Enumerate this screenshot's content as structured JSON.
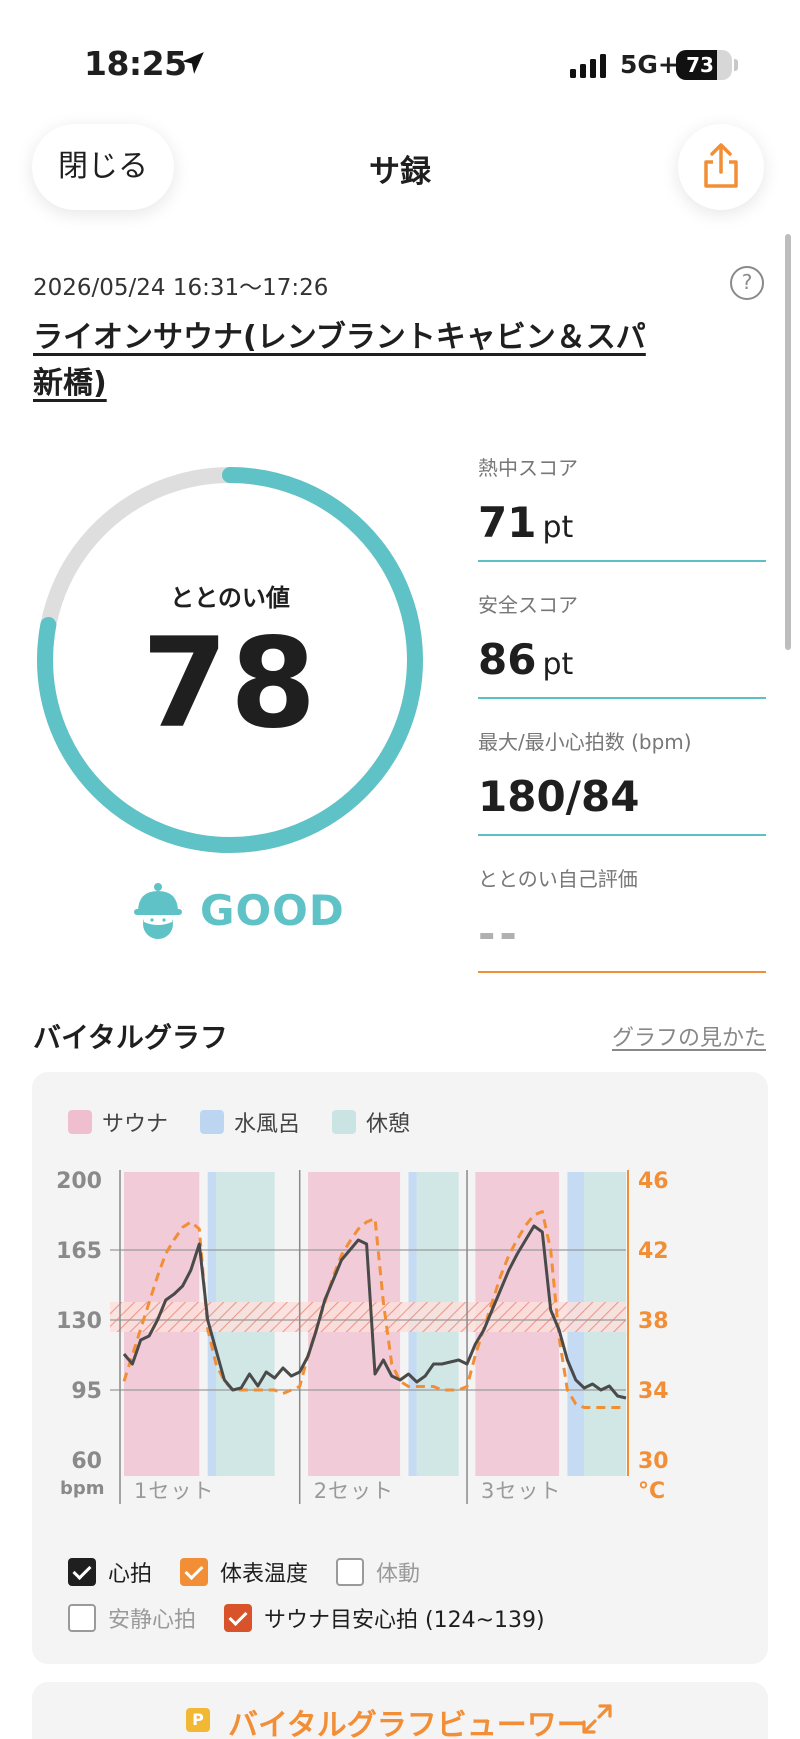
{
  "status_bar": {
    "time": "18:25",
    "network": "5G+",
    "battery": "73",
    "battery_level": 0.73
  },
  "header": {
    "close_label": "閉じる",
    "title": "サ録"
  },
  "record": {
    "datetime": "2026/05/24 16:31〜17:26",
    "facility": "ライオンサウナ(レンブラントキャビン＆スパ新橋)"
  },
  "gauge": {
    "label": "ととのい値",
    "value": "78",
    "level": 0.78,
    "rating": "GOOD"
  },
  "scores": [
    {
      "label": "熱中スコア",
      "value": "71",
      "unit": "pt"
    },
    {
      "label": "安全スコア",
      "value": "86",
      "unit": "pt"
    },
    {
      "label": "最大/最小心拍数 (bpm)",
      "value": "180/84",
      "unit": ""
    },
    {
      "label": "ととのい自己評価",
      "value": "--",
      "unit": ""
    }
  ],
  "vital": {
    "title": "バイタルグラフ",
    "howto_link": "グラフの見かた",
    "legend": [
      {
        "label": "サウナ",
        "color": "#f0bfcf"
      },
      {
        "label": "水風呂",
        "color": "#bcd6f2"
      },
      {
        "label": "休憩",
        "color": "#c9e4e3"
      }
    ],
    "checks": [
      {
        "label": "心拍",
        "checked": true,
        "color": "#1f1f1f"
      },
      {
        "label": "体表温度",
        "checked": true,
        "color": "#f28e36"
      },
      {
        "label": "体動",
        "checked": false,
        "color": ""
      },
      {
        "label": "安静心拍",
        "checked": false,
        "color": ""
      },
      {
        "label": "サウナ目安心拍 (124~139)",
        "checked": true,
        "color": "#d8532a"
      }
    ],
    "viewer_label": "バイタルグラフビューワー",
    "viewer_badge": "P"
  },
  "chart_data": {
    "type": "line",
    "left_axis": {
      "label": "bpm",
      "ticks": [
        200,
        165,
        130,
        95,
        60
      ],
      "ylim": [
        60,
        200
      ]
    },
    "right_axis": {
      "label": "°C",
      "ticks": [
        46,
        42,
        38,
        34,
        30
      ],
      "ylim": [
        30,
        46
      ]
    },
    "set_labels": [
      "1セット",
      "2セット",
      "3セット"
    ],
    "target_zone": [
      124,
      139
    ],
    "phases": [
      {
        "type": "sauna",
        "start": 0,
        "end": 9
      },
      {
        "type": "water",
        "start": 10,
        "end": 11
      },
      {
        "type": "rest",
        "start": 11,
        "end": 18
      },
      {
        "type": "sauna",
        "start": 22,
        "end": 33
      },
      {
        "type": "water",
        "start": 34,
        "end": 35
      },
      {
        "type": "rest",
        "start": 35,
        "end": 40
      },
      {
        "type": "sauna",
        "start": 42,
        "end": 52
      },
      {
        "type": "water",
        "start": 53,
        "end": 55
      },
      {
        "type": "rest",
        "start": 55,
        "end": 60
      }
    ],
    "set_boundaries": [
      0,
      21,
      41
    ],
    "series": [
      {
        "name": "心拍",
        "axis": "left",
        "x": [
          0,
          1,
          2,
          3,
          4,
          5,
          6,
          7,
          8,
          9,
          10,
          11,
          12,
          13,
          14,
          15,
          16,
          17,
          18,
          19,
          20,
          21,
          22,
          23,
          24,
          25,
          26,
          27,
          28,
          29,
          30,
          31,
          32,
          33,
          34,
          35,
          36,
          37,
          38,
          39,
          40,
          41,
          42,
          43,
          44,
          45,
          46,
          47,
          48,
          49,
          50,
          51,
          52,
          53,
          54,
          55,
          56,
          57,
          58,
          59,
          60
        ],
        "values": [
          113,
          108,
          120,
          122,
          130,
          140,
          143,
          147,
          155,
          168,
          130,
          115,
          100,
          95,
          96,
          103,
          97,
          104,
          101,
          106,
          102,
          104,
          112,
          125,
          140,
          150,
          160,
          165,
          170,
          168,
          103,
          110,
          102,
          100,
          103,
          99,
          102,
          108,
          108,
          109,
          110,
          108,
          118,
          125,
          135,
          145,
          155,
          163,
          170,
          177,
          174,
          135,
          125,
          110,
          100,
          96,
          98,
          95,
          97,
          92,
          91
        ]
      },
      {
        "name": "体表温度",
        "axis": "right",
        "x": [
          0,
          1,
          2,
          3,
          4,
          5,
          6,
          7,
          8,
          9,
          10,
          11,
          12,
          13,
          14,
          15,
          16,
          17,
          18,
          19,
          20,
          21,
          22,
          23,
          24,
          25,
          26,
          27,
          28,
          29,
          30,
          31,
          32,
          33,
          34,
          35,
          36,
          37,
          38,
          39,
          40,
          41,
          42,
          43,
          44,
          45,
          46,
          47,
          48,
          49,
          50,
          51,
          52,
          53,
          54,
          55,
          56,
          57,
          58,
          59,
          60
        ],
        "values": [
          34.5,
          36,
          37.5,
          39,
          40.5,
          41.8,
          42.6,
          43.3,
          43.6,
          43.2,
          37.5,
          35.5,
          34.5,
          34,
          34,
          34,
          34,
          34,
          34,
          33.8,
          34,
          34.2,
          36,
          37.5,
          39,
          40.5,
          41.7,
          42.5,
          43.2,
          43.6,
          43.8,
          39,
          35.5,
          34.5,
          34.2,
          34.2,
          34.2,
          34.2,
          34,
          34,
          34,
          34.2,
          36,
          37.5,
          39,
          40.5,
          41.7,
          42.6,
          43.4,
          44,
          44.2,
          42,
          37,
          34,
          33.2,
          33,
          33,
          33,
          33,
          33,
          33
        ]
      }
    ]
  }
}
